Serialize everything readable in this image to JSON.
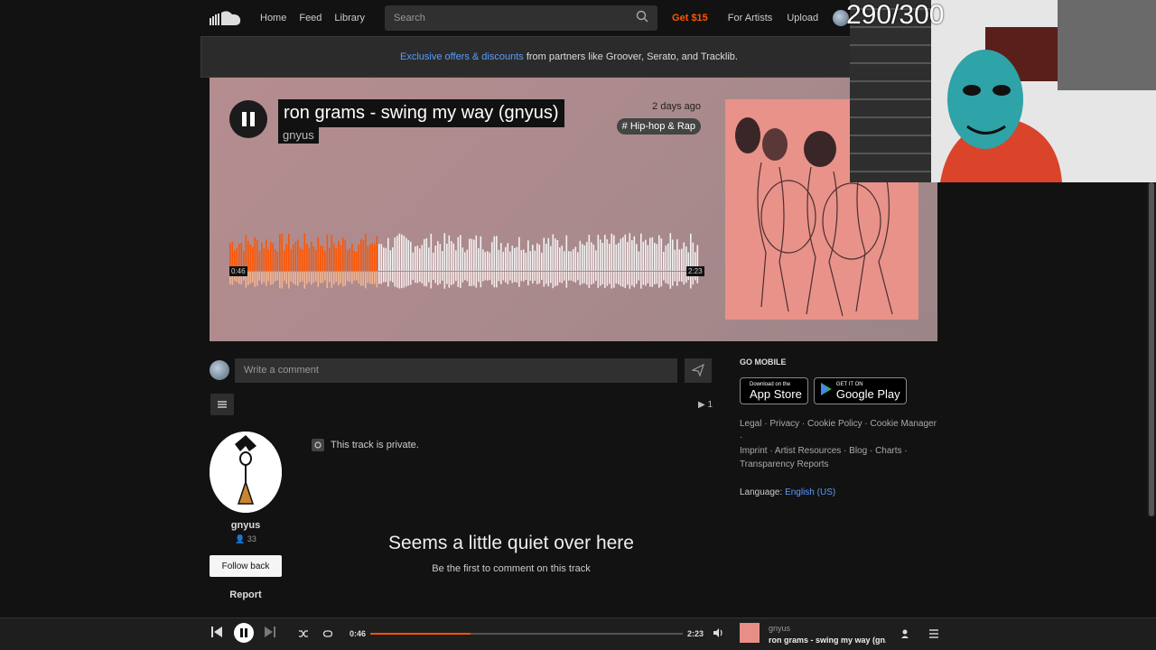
{
  "nav": {
    "home": "Home",
    "feed": "Feed",
    "library": "Library",
    "search_placeholder": "Search",
    "get15": "Get $15",
    "for_artists": "For Artists",
    "upload": "Upload"
  },
  "banner": {
    "link": "Exclusive offers & discounts",
    "text": " from partners like Groover, Serato, and Tracklib."
  },
  "track": {
    "title": "ron grams - swing my way (gnyus)",
    "artist": "gnyus",
    "posted": "2 days ago",
    "tag": "# Hip-hop & Rap",
    "elapsed": "0:46",
    "duration": "2:23",
    "progress": 0.32
  },
  "overlay": {
    "counter": "290/300"
  },
  "comments": {
    "placeholder": "Write a comment",
    "plays": "1",
    "private_note": "This track is private.",
    "empty_title": "Seems a little quiet over here",
    "empty_sub": "Be the first to comment on this track"
  },
  "uploader": {
    "name": "gnyus",
    "followers": "33",
    "follow_label": "Follow back",
    "report_label": "Report"
  },
  "sidebar": {
    "go_mobile": "GO MOBILE",
    "app_store_small": "Download on the",
    "app_store_big": "App Store",
    "google_small": "GET IT ON",
    "google_big": "Google Play",
    "links": [
      "Legal",
      "Privacy",
      "Cookie Policy",
      "Cookie Manager",
      "Imprint",
      "Artist Resources",
      "Blog",
      "Charts",
      "Transparency Reports"
    ],
    "language_label": "Language:",
    "language_value": "English (US)"
  },
  "player": {
    "elapsed": "0:46",
    "duration": "2:23",
    "artist": "gnyus",
    "title": "ron grams - swing my way (gn...",
    "progress": 0.32
  },
  "colors": {
    "accent": "#ff5500",
    "link": "#5a9cff"
  }
}
